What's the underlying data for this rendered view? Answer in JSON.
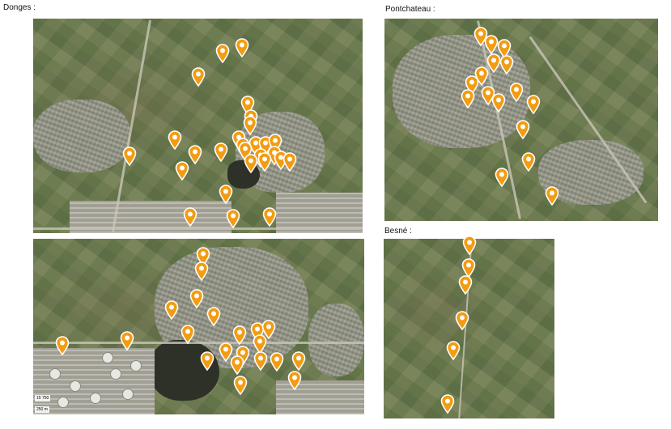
{
  "labels": {
    "donges": "Donges :",
    "pontchateau": "Pontchateau :",
    "besne": "Besné :"
  },
  "donges_map": {
    "scale_text": "15 750",
    "scale_distance": "250 m"
  },
  "pin_colors": {
    "fill": "#f39c12",
    "outline": "#ffffff",
    "dot": "#ffffff"
  },
  "icons": {
    "marker": "map-pin-icon"
  }
}
